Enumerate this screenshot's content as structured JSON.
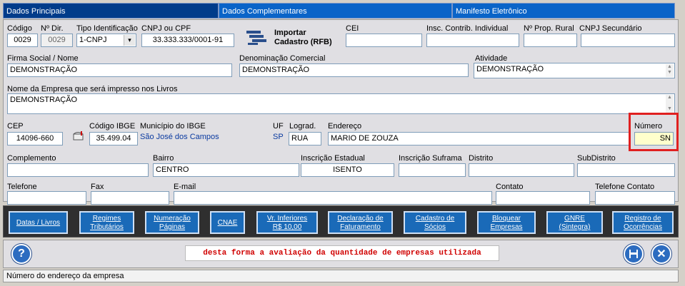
{
  "tabs": [
    "Dados Principais",
    "Dados Complementares",
    "Manifesto Eletrônico"
  ],
  "row1": {
    "codigo_label": "Código",
    "codigo": "0029",
    "ndir_label": "Nº Dir.",
    "ndir": "0029",
    "tipo_label": "Tipo Identificação",
    "tipo": "1-CNPJ",
    "cnpj_label": "CNPJ ou CPF",
    "cnpj": "33.333.333/0001-91",
    "importar_line1": "Importar",
    "importar_line2": "Cadastro (RFB)",
    "cei_label": "CEI",
    "cei": "",
    "insc_label": "Insc. Contrib. Individual",
    "insc": "",
    "prop_label": "Nº Prop. Rural",
    "prop": "",
    "cnpj_sec_label": "CNPJ Secundário",
    "cnpj_sec": ""
  },
  "row2": {
    "firma_label": "Firma Social / Nome",
    "firma": "DEMONSTRAÇÃO",
    "denom_label": "Denominação Comercial",
    "denom": "DEMONSTRAÇÃO",
    "ativ_label": "Atividade",
    "ativ": "DEMONSTRAÇÃO"
  },
  "row3": {
    "livros_label": "Nome da Empresa que será impresso nos Livros",
    "livros": "DEMONSTRAÇÃO"
  },
  "row4": {
    "cep_label": "CEP",
    "cep": "14096-660",
    "ibge_label": "Código IBGE",
    "ibge": "35.499.04",
    "mun_label": "Município do IBGE",
    "mun": "São José dos Campos",
    "uf_label": "UF",
    "uf": "SP",
    "lograd_label": "Lograd.",
    "lograd": "RUA",
    "end_label": "Endereço",
    "end": "MARIO DE ZOUZA",
    "num_label": "Número",
    "num": "SN"
  },
  "row5": {
    "compl_label": "Complemento",
    "compl": "",
    "bairro_label": "Bairro",
    "bairro": "CENTRO",
    "ie_label": "Inscrição Estadual",
    "ie": "ISENTO",
    "suframa_label": "Inscrição Suframa",
    "suframa": "",
    "distrito_label": "Distrito",
    "distrito": "",
    "subdistrito_label": "SubDistrito",
    "subdistrito": ""
  },
  "row6": {
    "tel_label": "Telefone",
    "tel": "",
    "fax_label": "Fax",
    "fax": "",
    "email_label": "E-mail",
    "email": "",
    "contato_label": "Contato",
    "contato": "",
    "tel_contato_label": "Telefone Contato",
    "tel_contato": ""
  },
  "buttons": [
    {
      "l1": "Datas / Livros",
      "l2": ""
    },
    {
      "l1": "Regimes",
      "l2": "Tributários"
    },
    {
      "l1": "Numeração",
      "l2": "Páginas"
    },
    {
      "l1": "CNAE",
      "l2": ""
    },
    {
      "l1": "Vr. Inferiores",
      "l2": "R$ 10,00"
    },
    {
      "l1": "Declaração de",
      "l2": "Faturamento"
    },
    {
      "l1": "Cadastro de",
      "l2": "Sócios"
    },
    {
      "l1": "Bloquear",
      "l2": "Empresas"
    },
    {
      "l1": "GNRE",
      "l2": "(Sintegra)"
    },
    {
      "l1": "Registro de",
      "l2": "Ocorrências"
    }
  ],
  "message": "desta forma a avaliação da quantidade de empresas utilizada",
  "status": "Número do endereço da empresa",
  "colors": {
    "tab_blue": "#0a64c8",
    "highlight": "#e02020",
    "message_red": "#d00000"
  }
}
